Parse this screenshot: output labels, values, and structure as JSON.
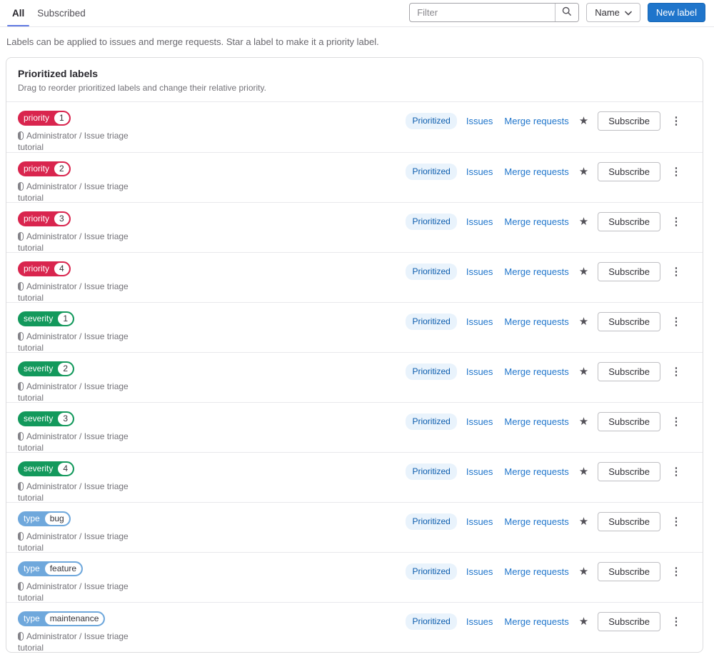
{
  "tabs": {
    "all": "All",
    "subscribed": "Subscribed"
  },
  "toolbar": {
    "filter_placeholder": "Filter",
    "search_icon": "magnifier-icon",
    "sort_button": "Name",
    "sort_chevron_icon": "chevron-down-icon",
    "new_label_button": "New label",
    "new_label_color": "#1f75cb",
    "active_tab_indicator_color": "#617ae2"
  },
  "description": "Labels can be applied to issues and merge requests. Star a label to make it a priority label.",
  "prioritized_card": {
    "title": "Prioritized labels",
    "subtitle": "Drag to reorder prioritized labels and change their relative priority."
  },
  "row_common": {
    "scoped_doc_icon": "scoped-label-icon",
    "project": "Administrator / Issue triage tutorial",
    "prioritized_badge": "Prioritized",
    "issues_link": "Issues",
    "merge_requests_link": "Merge requests",
    "star_icon": "star-filled-icon",
    "subscribe_button": "Subscribe",
    "more_icon": "kebab-menu-icon"
  },
  "label_colors": {
    "priority": "#d9254e",
    "severity": "#13995c",
    "type": "#6fa8dc"
  },
  "labels": [
    {
      "scope": "priority",
      "value": "1",
      "color": "#d9254e"
    },
    {
      "scope": "priority",
      "value": "2",
      "color": "#d9254e"
    },
    {
      "scope": "priority",
      "value": "3",
      "color": "#d9254e"
    },
    {
      "scope": "priority",
      "value": "4",
      "color": "#d9254e"
    },
    {
      "scope": "severity",
      "value": "1",
      "color": "#13995c"
    },
    {
      "scope": "severity",
      "value": "2",
      "color": "#13995c"
    },
    {
      "scope": "severity",
      "value": "3",
      "color": "#13995c"
    },
    {
      "scope": "severity",
      "value": "4",
      "color": "#13995c"
    },
    {
      "scope": "type",
      "value": "bug",
      "color": "#6fa8dc"
    },
    {
      "scope": "type",
      "value": "feature",
      "color": "#6fa8dc"
    },
    {
      "scope": "type",
      "value": "maintenance",
      "color": "#6fa8dc"
    }
  ],
  "badge_colors": {
    "prioritized_bg": "#e9f3fc",
    "prioritized_text": "#0b5cad",
    "link": "#1f75cb"
  }
}
